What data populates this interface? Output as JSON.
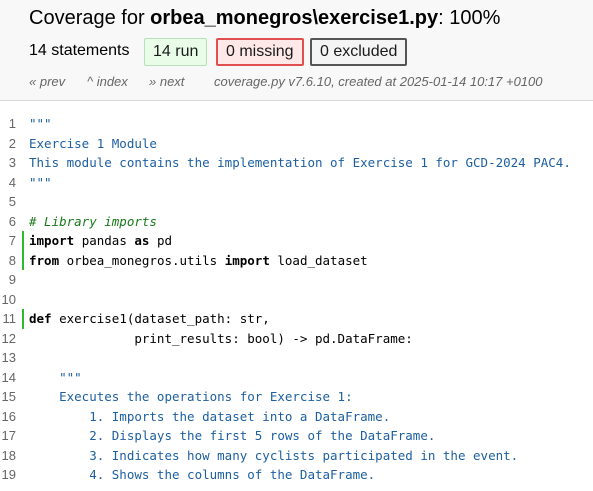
{
  "header": {
    "title_prefix": "Coverage for ",
    "title_file": "orbea_monegros\\exercise1.py",
    "title_suffix": ": 100%",
    "statements": "14 statements",
    "run_label": "14 run",
    "missing_label": "0 missing",
    "excluded_label": "0 excluded"
  },
  "nav": {
    "prev": "« prev",
    "index": "^ index",
    "next": "» next",
    "created": "coverage.py v7.6.10, created at 2025-01-14 10:17 +0100"
  },
  "colors": {
    "run_marker": "#2db82d",
    "docstring": "#1d5fa0",
    "comment": "#1a7a1a",
    "missing_border": "#e05050"
  },
  "source": {
    "lines": [
      {
        "n": "1",
        "run": false,
        "text": "\"\"\"",
        "kind": "str"
      },
      {
        "n": "2",
        "run": false,
        "text": "Exercise 1 Module",
        "kind": "str"
      },
      {
        "n": "3",
        "run": false,
        "text": "This module contains the implementation of Exercise 1 for GCD-2024 PAC4.",
        "kind": "str"
      },
      {
        "n": "4",
        "run": false,
        "text": "\"\"\"",
        "kind": "str"
      },
      {
        "n": "5",
        "run": false,
        "text": "",
        "kind": "plain"
      },
      {
        "n": "6",
        "run": false,
        "text": "# Library imports",
        "kind": "com"
      },
      {
        "n": "7",
        "run": true,
        "text": "import pandas as pd",
        "kind": "code"
      },
      {
        "n": "8",
        "run": true,
        "text": "from orbea_monegros.utils import load_dataset",
        "kind": "code"
      },
      {
        "n": "9",
        "run": false,
        "text": "",
        "kind": "plain"
      },
      {
        "n": "10",
        "run": false,
        "text": "",
        "kind": "plain"
      },
      {
        "n": "11",
        "run": true,
        "text": "def exercise1(dataset_path: str,",
        "kind": "code"
      },
      {
        "n": "12",
        "run": false,
        "text": "              print_results: bool) -> pd.DataFrame:",
        "kind": "plain"
      },
      {
        "n": "13",
        "run": false,
        "text": "",
        "kind": "plain"
      },
      {
        "n": "14",
        "run": false,
        "text": "    \"\"\"",
        "kind": "str"
      },
      {
        "n": "15",
        "run": false,
        "text": "    Executes the operations for Exercise 1:",
        "kind": "str"
      },
      {
        "n": "16",
        "run": false,
        "text": "        1. Imports the dataset into a DataFrame.",
        "kind": "str"
      },
      {
        "n": "17",
        "run": false,
        "text": "        2. Displays the first 5 rows of the DataFrame.",
        "kind": "str"
      },
      {
        "n": "18",
        "run": false,
        "text": "        3. Indicates how many cyclists participated in the event.",
        "kind": "str"
      },
      {
        "n": "19",
        "run": false,
        "text": "        4. Shows the columns of the DataFrame.",
        "kind": "str"
      }
    ]
  }
}
